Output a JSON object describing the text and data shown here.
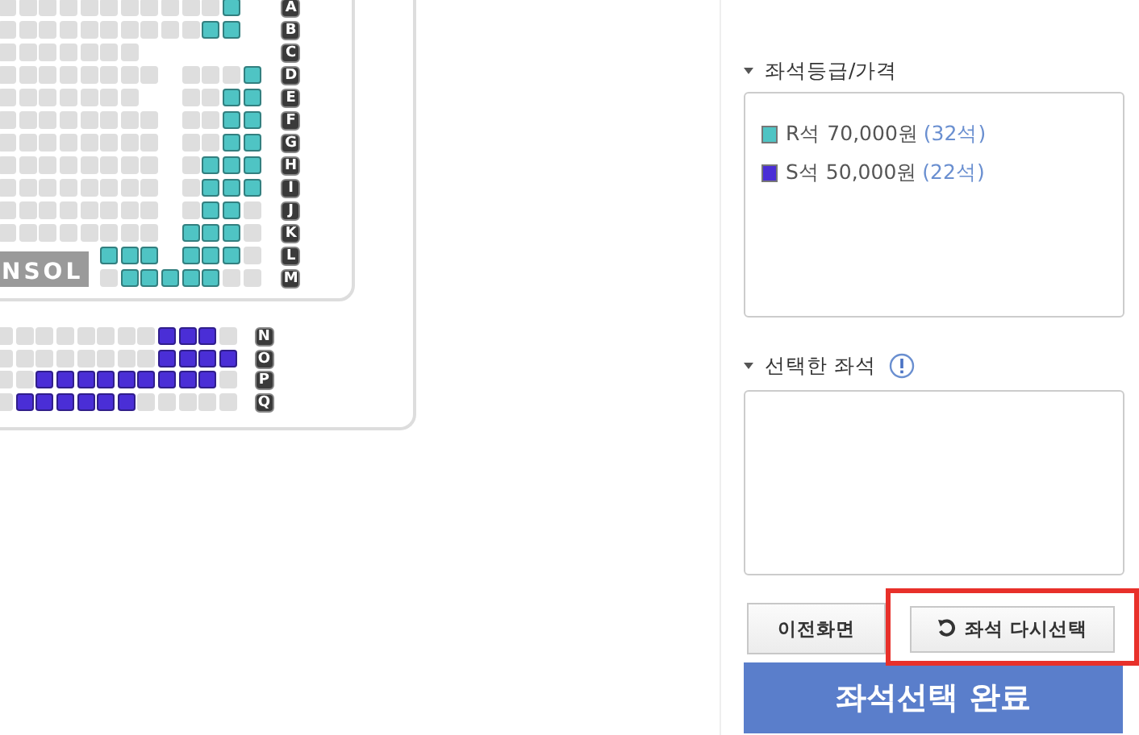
{
  "seat_map": {
    "stage_label": "NSOL",
    "upper_rows": [
      {
        "label": "A",
        "seats": [
          {
            "kind": "sold"
          },
          {
            "kind": "sold"
          },
          {
            "kind": "sold"
          },
          {
            "kind": "sold"
          },
          {
            "kind": "sold"
          },
          {
            "kind": "sold"
          },
          {
            "kind": "sold"
          },
          {
            "kind": "sold"
          },
          {
            "kind": "sold"
          },
          {
            "kind": "sold"
          },
          {
            "kind": "sold"
          },
          {
            "kind": "open",
            "color": "#4fc4c4"
          },
          {
            "kind": "gap"
          }
        ]
      },
      {
        "label": "B",
        "seats": [
          {
            "kind": "sold"
          },
          {
            "kind": "sold"
          },
          {
            "kind": "sold"
          },
          {
            "kind": "sold"
          },
          {
            "kind": "sold"
          },
          {
            "kind": "sold"
          },
          {
            "kind": "sold"
          },
          {
            "kind": "sold"
          },
          {
            "kind": "sold"
          },
          {
            "kind": "sold"
          },
          {
            "kind": "open",
            "color": "#4fc4c4"
          },
          {
            "kind": "open",
            "color": "#4fc4c4"
          },
          {
            "kind": "gap"
          }
        ]
      },
      {
        "label": "C",
        "seats": [
          {
            "kind": "sold"
          },
          {
            "kind": "sold"
          },
          {
            "kind": "sold"
          },
          {
            "kind": "sold"
          },
          {
            "kind": "sold"
          },
          {
            "kind": "sold"
          },
          {
            "kind": "sold"
          },
          {
            "kind": "gap"
          },
          {
            "kind": "gap"
          },
          {
            "kind": "gap"
          },
          {
            "kind": "gap"
          },
          {
            "kind": "gap"
          },
          {
            "kind": "gap"
          }
        ]
      },
      {
        "label": "D",
        "seats": [
          {
            "kind": "sold"
          },
          {
            "kind": "sold"
          },
          {
            "kind": "sold"
          },
          {
            "kind": "sold"
          },
          {
            "kind": "sold"
          },
          {
            "kind": "sold"
          },
          {
            "kind": "sold"
          },
          {
            "kind": "sold"
          },
          {
            "kind": "gap"
          },
          {
            "kind": "sold"
          },
          {
            "kind": "sold"
          },
          {
            "kind": "sold"
          },
          {
            "kind": "open",
            "color": "#4fc4c4"
          }
        ]
      },
      {
        "label": "E",
        "seats": [
          {
            "kind": "sold"
          },
          {
            "kind": "sold"
          },
          {
            "kind": "sold"
          },
          {
            "kind": "sold"
          },
          {
            "kind": "sold"
          },
          {
            "kind": "sold"
          },
          {
            "kind": "sold"
          },
          {
            "kind": "gap"
          },
          {
            "kind": "gap"
          },
          {
            "kind": "sold"
          },
          {
            "kind": "sold"
          },
          {
            "kind": "open",
            "color": "#4fc4c4"
          },
          {
            "kind": "open",
            "color": "#4fc4c4"
          }
        ]
      },
      {
        "label": "F",
        "seats": [
          {
            "kind": "sold"
          },
          {
            "kind": "sold"
          },
          {
            "kind": "sold"
          },
          {
            "kind": "sold"
          },
          {
            "kind": "sold"
          },
          {
            "kind": "sold"
          },
          {
            "kind": "sold"
          },
          {
            "kind": "sold"
          },
          {
            "kind": "gap"
          },
          {
            "kind": "sold"
          },
          {
            "kind": "sold"
          },
          {
            "kind": "open",
            "color": "#4fc4c4"
          },
          {
            "kind": "open",
            "color": "#4fc4c4"
          }
        ]
      },
      {
        "label": "G",
        "seats": [
          {
            "kind": "sold"
          },
          {
            "kind": "sold"
          },
          {
            "kind": "sold"
          },
          {
            "kind": "sold"
          },
          {
            "kind": "sold"
          },
          {
            "kind": "sold"
          },
          {
            "kind": "sold"
          },
          {
            "kind": "sold"
          },
          {
            "kind": "gap"
          },
          {
            "kind": "sold"
          },
          {
            "kind": "sold"
          },
          {
            "kind": "open",
            "color": "#4fc4c4"
          },
          {
            "kind": "open",
            "color": "#4fc4c4"
          }
        ]
      },
      {
        "label": "H",
        "seats": [
          {
            "kind": "sold"
          },
          {
            "kind": "sold"
          },
          {
            "kind": "sold"
          },
          {
            "kind": "sold"
          },
          {
            "kind": "sold"
          },
          {
            "kind": "sold"
          },
          {
            "kind": "sold"
          },
          {
            "kind": "sold"
          },
          {
            "kind": "gap"
          },
          {
            "kind": "sold"
          },
          {
            "kind": "open",
            "color": "#4fc4c4"
          },
          {
            "kind": "open",
            "color": "#4fc4c4"
          },
          {
            "kind": "open",
            "color": "#4fc4c4"
          }
        ]
      },
      {
        "label": "I",
        "seats": [
          {
            "kind": "sold"
          },
          {
            "kind": "sold"
          },
          {
            "kind": "sold"
          },
          {
            "kind": "sold"
          },
          {
            "kind": "sold"
          },
          {
            "kind": "sold"
          },
          {
            "kind": "sold"
          },
          {
            "kind": "sold"
          },
          {
            "kind": "gap"
          },
          {
            "kind": "sold"
          },
          {
            "kind": "open",
            "color": "#4fc4c4"
          },
          {
            "kind": "open",
            "color": "#4fc4c4"
          },
          {
            "kind": "open",
            "color": "#4fc4c4"
          }
        ]
      },
      {
        "label": "J",
        "seats": [
          {
            "kind": "sold"
          },
          {
            "kind": "sold"
          },
          {
            "kind": "sold"
          },
          {
            "kind": "sold"
          },
          {
            "kind": "sold"
          },
          {
            "kind": "sold"
          },
          {
            "kind": "sold"
          },
          {
            "kind": "sold"
          },
          {
            "kind": "gap"
          },
          {
            "kind": "sold"
          },
          {
            "kind": "open",
            "color": "#4fc4c4"
          },
          {
            "kind": "open",
            "color": "#4fc4c4"
          },
          {
            "kind": "sold"
          }
        ]
      },
      {
        "label": "K",
        "seats": [
          {
            "kind": "sold"
          },
          {
            "kind": "sold"
          },
          {
            "kind": "sold"
          },
          {
            "kind": "sold"
          },
          {
            "kind": "sold"
          },
          {
            "kind": "sold"
          },
          {
            "kind": "sold"
          },
          {
            "kind": "sold"
          },
          {
            "kind": "gap"
          },
          {
            "kind": "open",
            "color": "#4fc4c4"
          },
          {
            "kind": "open",
            "color": "#4fc4c4"
          },
          {
            "kind": "open",
            "color": "#4fc4c4"
          },
          {
            "kind": "sold"
          }
        ]
      },
      {
        "label": "L",
        "seats": [
          {
            "kind": "gap"
          },
          {
            "kind": "gap"
          },
          {
            "kind": "gap"
          },
          {
            "kind": "gap"
          },
          {
            "kind": "gap"
          },
          {
            "kind": "open",
            "color": "#4fc4c4"
          },
          {
            "kind": "open",
            "color": "#4fc4c4"
          },
          {
            "kind": "open",
            "color": "#4fc4c4"
          },
          {
            "kind": "gap"
          },
          {
            "kind": "open",
            "color": "#4fc4c4"
          },
          {
            "kind": "open",
            "color": "#4fc4c4"
          },
          {
            "kind": "open",
            "color": "#4fc4c4"
          },
          {
            "kind": "sold"
          }
        ]
      },
      {
        "label": "M",
        "seats": [
          {
            "kind": "gap"
          },
          {
            "kind": "gap"
          },
          {
            "kind": "gap"
          },
          {
            "kind": "gap"
          },
          {
            "kind": "gap"
          },
          {
            "kind": "sold"
          },
          {
            "kind": "open",
            "color": "#4fc4c4"
          },
          {
            "kind": "open",
            "color": "#4fc4c4"
          },
          {
            "kind": "open",
            "color": "#4fc4c4"
          },
          {
            "kind": "open",
            "color": "#4fc4c4"
          },
          {
            "kind": "open",
            "color": "#4fc4c4"
          },
          {
            "kind": "sold"
          },
          {
            "kind": "sold"
          }
        ]
      }
    ],
    "lower_rows": [
      {
        "label": "N",
        "seats": [
          {
            "kind": "sold"
          },
          {
            "kind": "sold"
          },
          {
            "kind": "sold"
          },
          {
            "kind": "sold"
          },
          {
            "kind": "sold"
          },
          {
            "kind": "sold"
          },
          {
            "kind": "sold"
          },
          {
            "kind": "sold"
          },
          {
            "kind": "open",
            "color": "#4a2ed6"
          },
          {
            "kind": "open",
            "color": "#4a2ed6"
          },
          {
            "kind": "open",
            "color": "#4a2ed6"
          },
          {
            "kind": "sold"
          }
        ]
      },
      {
        "label": "O",
        "seats": [
          {
            "kind": "sold"
          },
          {
            "kind": "sold"
          },
          {
            "kind": "sold"
          },
          {
            "kind": "sold"
          },
          {
            "kind": "sold"
          },
          {
            "kind": "sold"
          },
          {
            "kind": "sold"
          },
          {
            "kind": "sold"
          },
          {
            "kind": "open",
            "color": "#4a2ed6"
          },
          {
            "kind": "open",
            "color": "#4a2ed6"
          },
          {
            "kind": "open",
            "color": "#4a2ed6"
          },
          {
            "kind": "open",
            "color": "#4a2ed6"
          }
        ]
      },
      {
        "label": "P",
        "seats": [
          {
            "kind": "sold"
          },
          {
            "kind": "sold"
          },
          {
            "kind": "open",
            "color": "#4a2ed6"
          },
          {
            "kind": "open",
            "color": "#4a2ed6"
          },
          {
            "kind": "open",
            "color": "#4a2ed6"
          },
          {
            "kind": "open",
            "color": "#4a2ed6"
          },
          {
            "kind": "open",
            "color": "#4a2ed6"
          },
          {
            "kind": "open",
            "color": "#4a2ed6"
          },
          {
            "kind": "open",
            "color": "#4a2ed6"
          },
          {
            "kind": "open",
            "color": "#4a2ed6"
          },
          {
            "kind": "open",
            "color": "#4a2ed6"
          },
          {
            "kind": "sold"
          }
        ]
      },
      {
        "label": "Q",
        "seats": [
          {
            "kind": "sold"
          },
          {
            "kind": "open",
            "color": "#4a2ed6"
          },
          {
            "kind": "open",
            "color": "#4a2ed6"
          },
          {
            "kind": "open",
            "color": "#4a2ed6"
          },
          {
            "kind": "open",
            "color": "#4a2ed6"
          },
          {
            "kind": "open",
            "color": "#4a2ed6"
          },
          {
            "kind": "open",
            "color": "#4a2ed6"
          },
          {
            "kind": "sold"
          },
          {
            "kind": "sold"
          },
          {
            "kind": "sold"
          },
          {
            "kind": "sold"
          },
          {
            "kind": "sold"
          }
        ]
      }
    ]
  },
  "panel": {
    "grade_heading": "좌석등급/가격",
    "grades": [
      {
        "label": "R석 70,000원",
        "count": "(32석)",
        "color": "#4fc4c4"
      },
      {
        "label": "S석 50,000원",
        "count": "(22석)",
        "color": "#4a2ed6"
      }
    ],
    "selected_heading": "선택한 좌석",
    "back_button": "이전화면",
    "reset_button": {
      "label": "좌석 다시선택",
      "highlighted": true
    },
    "confirm_button": "좌석선택 완료"
  }
}
